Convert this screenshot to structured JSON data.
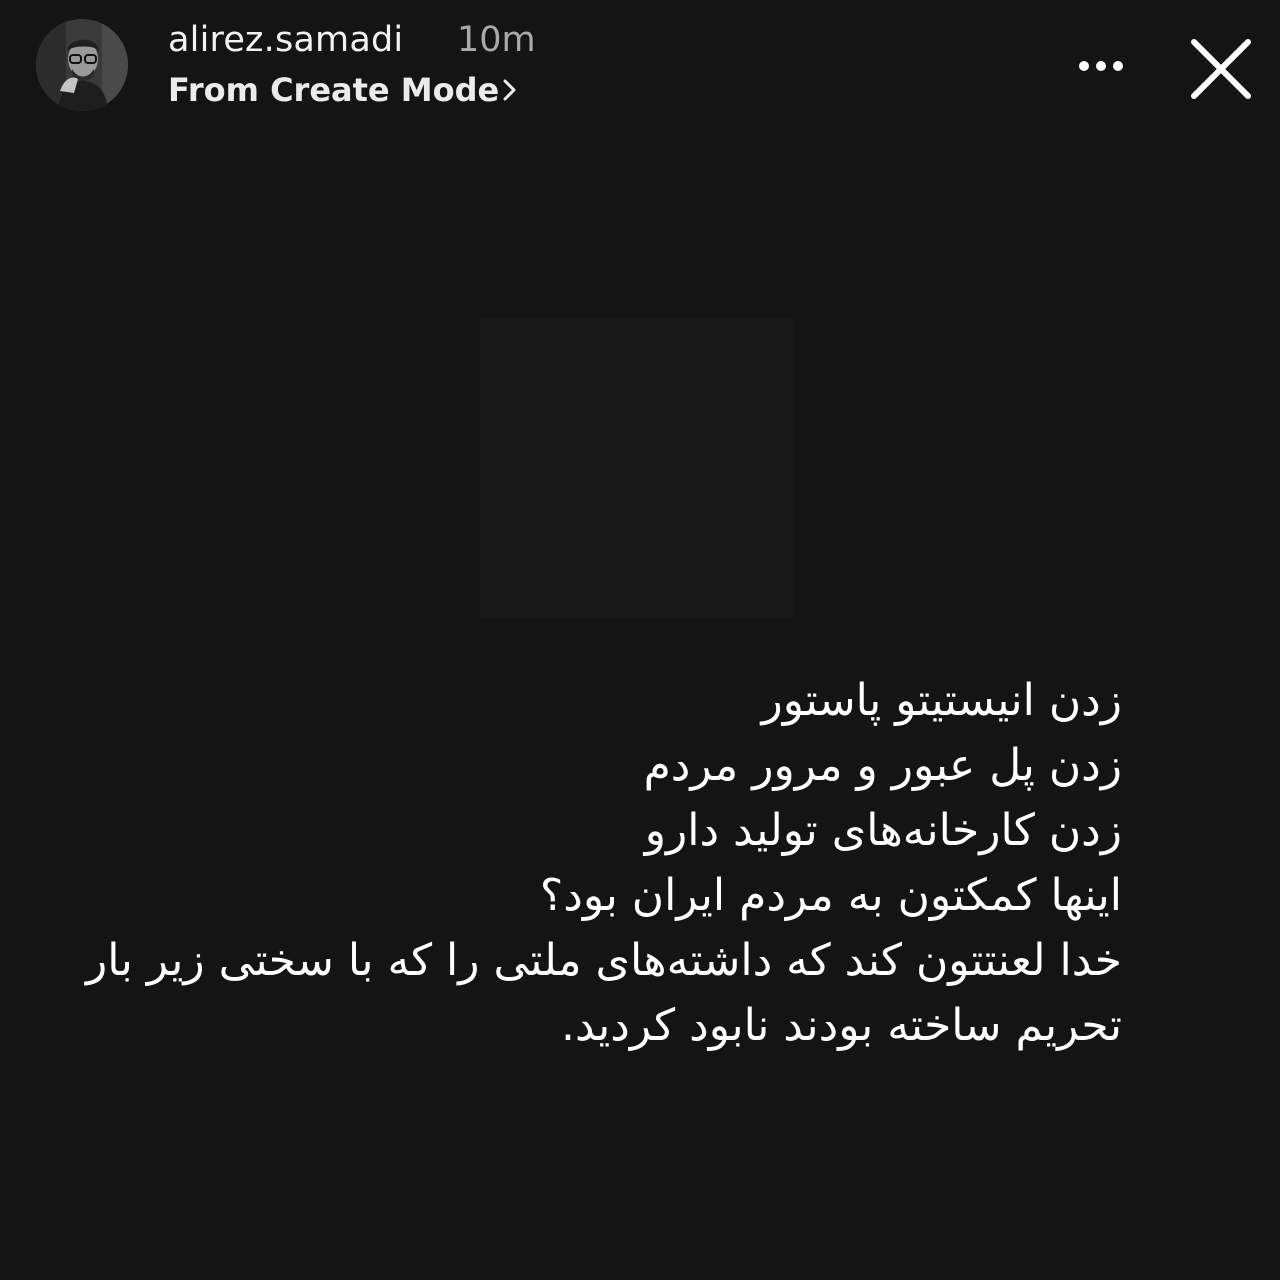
{
  "header": {
    "username": "alirez.samadi",
    "time": "10m",
    "subtitle": "From Create Mode",
    "subtitle_icon": "chevron-right-icon",
    "more_icon": "more-dots-icon",
    "close_icon": "close-icon"
  },
  "story": {
    "lines": [
      "زدن انیستیتو پاستور",
      "زدن پل عبور و مرور  مردم",
      "زدن کارخانه‌های تولید دارو",
      "اینها کمکتون به مردم ایران بود؟",
      "خدا لعنتتون کند که داشته‌های ملتی را که با سختی زیر بار",
      "تحریم ساخته بودند نابود کردید."
    ]
  },
  "colors": {
    "background": "#141414",
    "text": "#ffffff",
    "muted": "#a9a9a9"
  }
}
